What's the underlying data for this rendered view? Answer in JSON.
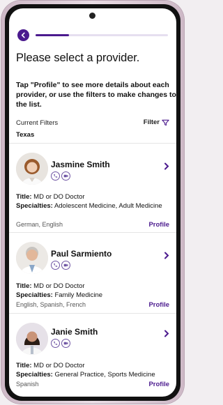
{
  "header": {
    "back_icon": "back-arrow-icon",
    "progress": 0.25
  },
  "page": {
    "title": "Please select a provider.",
    "intro": "Tap \"Profile\" to see more details about each provider, or use the filters to make changes to the list."
  },
  "filters": {
    "label": "Current Filters",
    "button_label": "Filter",
    "current_value": "Texas"
  },
  "providers": [
    {
      "name": "Jasmine Smith",
      "title_label": "Title:",
      "title": "MD or DO Doctor",
      "specialties_label": "Specialties:",
      "specialties": "Adolescent Medicine, Adult Medicine",
      "languages": "German, English",
      "profile_label": "Profile"
    },
    {
      "name": "Paul Sarmiento",
      "title_label": "Title:",
      "title": "MD or DO Doctor",
      "specialties_label": "Specialties:",
      "specialties": "Family Medicine",
      "languages": "English, Spanish, French",
      "profile_label": "Profile"
    },
    {
      "name": "Janie Smith",
      "title_label": "Title:",
      "title": "MD or DO Doctor",
      "specialties_label": "Specialties:",
      "specialties": "General Practice, Sports Medicine",
      "languages": "Spanish",
      "profile_label": "Profile"
    }
  ],
  "colors": {
    "accent": "#4b1a8e"
  }
}
